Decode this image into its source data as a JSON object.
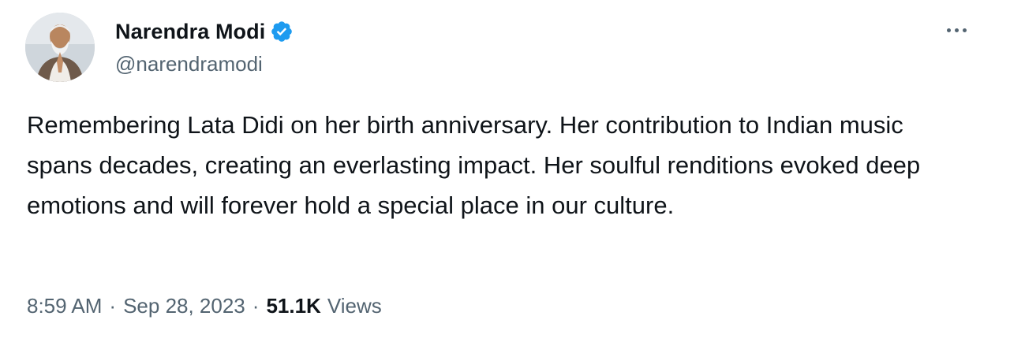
{
  "author": {
    "display_name": "Narendra Modi",
    "handle": "@narendramodi",
    "verified": true,
    "verified_color": "#1d9bf0"
  },
  "icons": {
    "avatar": "profile-photo",
    "verified": "verified-badge-icon",
    "more": "more-options-icon"
  },
  "tweet": {
    "text": "Remembering Lata Didi on her birth anniversary. Her contribution to Indian music spans decades, creating an everlasting impact. Her soulful renditions evoked deep emotions and will forever hold a special place in our culture.",
    "time": "8:59 AM",
    "separator": "·",
    "date": "Sep 28, 2023",
    "views_count": "51.1K",
    "views_label": "Views"
  }
}
